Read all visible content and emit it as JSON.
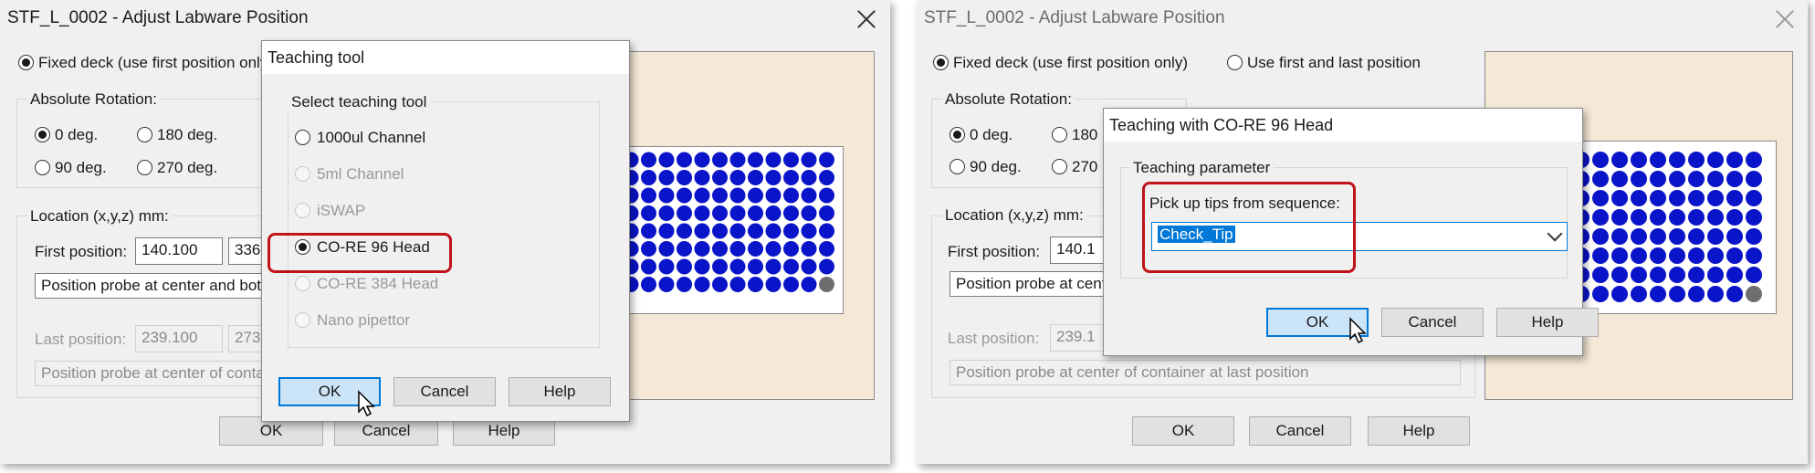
{
  "left": {
    "title": "STF_L_0002 - Adjust Labware Position",
    "fixed_deck": "Fixed deck (use first position only)",
    "abs_rotation": "Absolute Rotation:",
    "rot0": "0 deg.",
    "rot180": "180 deg.",
    "rot90": "90 deg.",
    "rot270": "270 deg.",
    "location": "Location (x,y,z) mm:",
    "first_pos_label": "First position:",
    "first_x": "140.100",
    "first_y": "336.",
    "probe_first": "Position probe at center and bot",
    "last_pos_label": "Last position:",
    "last_x": "239.100",
    "last_y": "273.",
    "probe_last": "Position probe at center of conta",
    "ok": "OK",
    "cancel": "Cancel",
    "help": "Help"
  },
  "teaching_tool": {
    "title": "Teaching tool",
    "group": "Select teaching tool",
    "options": [
      "1000ul Channel",
      "5ml Channel",
      "iSWAP",
      "CO-RE 96 Head",
      "CO-RE 384 Head",
      "Nano pipettor"
    ],
    "selected": "CO-RE 96 Head",
    "ok": "OK",
    "cancel": "Cancel",
    "help": "Help"
  },
  "right": {
    "title": "STF_L_0002 - Adjust Labware Position",
    "fixed_deck": "Fixed deck (use first position only)",
    "first_last": "Use first and last position",
    "abs_rotation": "Absolute Rotation:",
    "rot0": "0 deg.",
    "rot180": "180",
    "rot90": "90 deg.",
    "rot270": "270",
    "location": "Location (x,y,z) mm:",
    "first_pos_label": "First position:",
    "first_x": "140.1",
    "probe_first": "Position probe at cente",
    "last_pos_label": "Last position:",
    "last_x": "239.1",
    "probe_last": "Position probe at center of container at last position",
    "ok": "OK",
    "cancel": "Cancel",
    "help": "Help"
  },
  "teaching_96": {
    "title": "Teaching with CO-RE 96 Head",
    "group": "Teaching parameter",
    "pick_label": "Pick up tips from sequence:",
    "sequence": "Check_Tip",
    "ok": "OK",
    "cancel": "Cancel",
    "help": "Help"
  },
  "colors": {
    "well": "#0a14c8",
    "well_last": "#6e6e6e",
    "highlight": "#c0141b",
    "panel": "#f5e8d7"
  }
}
